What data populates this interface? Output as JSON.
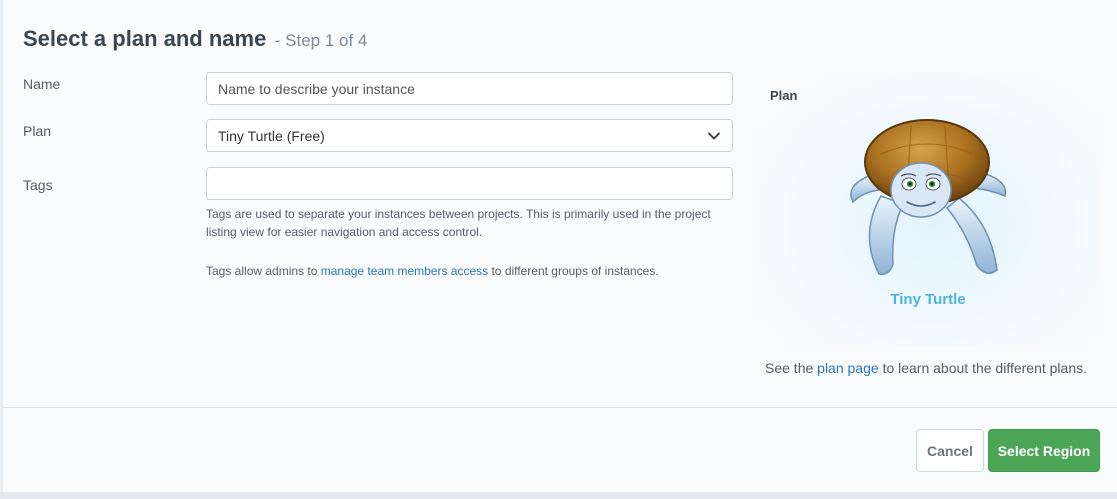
{
  "header": {
    "title": "Select a plan and name",
    "step": "- Step 1 of 4"
  },
  "form": {
    "name": {
      "label": "Name",
      "placeholder": "Name to describe your instance",
      "value": ""
    },
    "plan": {
      "label": "Plan",
      "selected": "Tiny Turtle (Free)"
    },
    "tags": {
      "label": "Tags",
      "value": "",
      "help_line1": "Tags are used to separate your instances between projects. This is primarily used in the project",
      "help_line2": "listing view for easier navigation and access control.",
      "help2_prefix": "Tags allow admins to ",
      "help2_link": "manage team members access",
      "help2_suffix": " to different groups of instances."
    }
  },
  "plan_panel": {
    "label": "Plan",
    "plan_name": "Tiny Turtle",
    "image_icon": "turtle-icon",
    "note_prefix": "See the ",
    "note_link": "plan page",
    "note_suffix": " to learn about the different plans."
  },
  "footer": {
    "cancel_label": "Cancel",
    "next_label": "Select Region"
  },
  "colors": {
    "primary_button": "#4ba657",
    "link": "#2878b8",
    "plan_name": "#4fb4dd"
  }
}
